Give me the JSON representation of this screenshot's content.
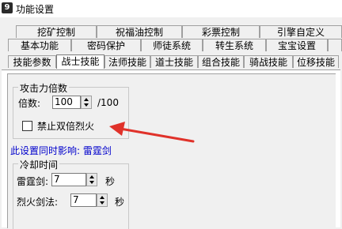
{
  "window": {
    "title": "功能设置",
    "icon_glyph": "9"
  },
  "tabs_row1": [
    "挖矿控制",
    "祝福油控制",
    "彩票控制",
    "引擎自定义"
  ],
  "tabs_row2": [
    "基本功能",
    "密码保护",
    "师徒系统",
    "转生系统",
    "宝宝设置"
  ],
  "tabs_row3": [
    "技能参数",
    "战士技能",
    "法师技能",
    "道士技能",
    "组合技能",
    "骑战技能",
    "位移技能"
  ],
  "active_tab": "战士技能",
  "attack_group": {
    "title": "攻击力倍数",
    "multiplier_label": "倍数:",
    "multiplier_value": "100",
    "multiplier_suffix": "/100",
    "checkbox_label": "禁止双倍烈火",
    "checkbox_checked": false
  },
  "note": "此设置同时影响: 雷霆剑",
  "cooldown_group": {
    "title": "冷却时间",
    "thunder_label": "雷霆剑:",
    "thunder_value": "7",
    "thunder_unit": "秒",
    "fire_label": "烈火剑法:",
    "fire_value": "7",
    "fire_unit": "秒"
  },
  "colors": {
    "arrow": "#e0322a",
    "note_text": "#0000cc"
  }
}
